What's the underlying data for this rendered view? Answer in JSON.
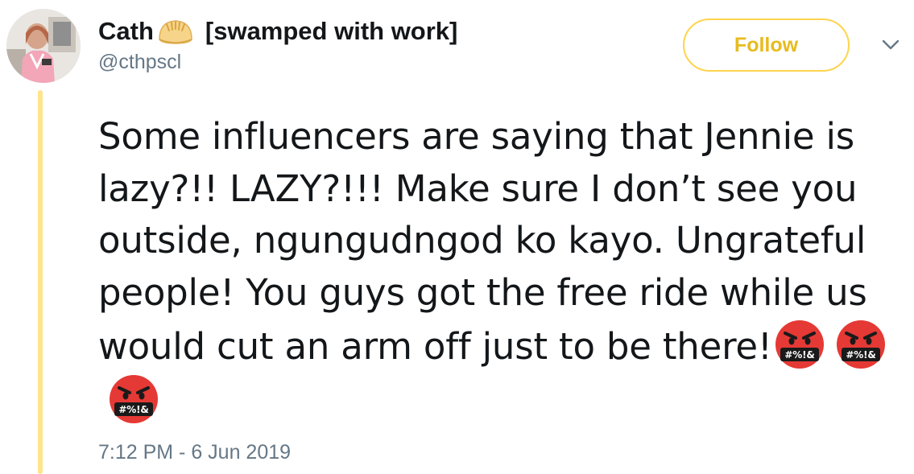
{
  "tweet": {
    "author": {
      "display_name": "Cath",
      "name_emoji": "dumpling-emoji",
      "status_suffix": "[swamped with work]",
      "handle": "@cthpscl"
    },
    "follow_button_label": "Follow",
    "more_icon": "chevron-down-icon",
    "text_main": "Some influencers are saying that Jennie is lazy?!! LAZY?!!! Make sure I don’t see you outside, ngungudngod ko kayo. Ungrateful people! You guys got the free ride while us would cut an arm off just to be there!",
    "trailing_emojis": [
      {
        "icon": "cursing-face-emoji",
        "label": "#%!&"
      },
      {
        "icon": "cursing-face-emoji",
        "label": "#%!&"
      },
      {
        "icon": "cursing-face-emoji",
        "label": "#%!&"
      }
    ],
    "timestamp": "7:12 PM - 6 Jun 2019"
  },
  "colors": {
    "accent": "#fdd44d",
    "accent_text": "#e8bb1e",
    "thread_line": "#ffe48c",
    "secondary_text": "#657786",
    "primary_text": "#14171a",
    "emoji_red": "#e53935"
  }
}
